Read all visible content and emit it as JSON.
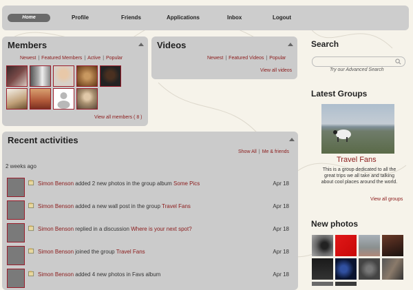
{
  "nav": {
    "home": "Home",
    "items": [
      "Profile",
      "Friends",
      "Applications",
      "Inbox",
      "Logout"
    ]
  },
  "members": {
    "title": "Members",
    "tabs": [
      "Newest",
      "Featured Members",
      "Active",
      "Popular"
    ],
    "view_all": "View all members ( 8 )"
  },
  "videos": {
    "title": "Videos",
    "tabs": [
      "Newest",
      "Featured Videos",
      "Popular"
    ],
    "view_all": "View all videos"
  },
  "activities": {
    "title": "Recent activities",
    "filters": [
      "Show All",
      "Me & friends"
    ],
    "group_label": "2 weeks ago",
    "items": [
      {
        "user": "Simon Benson",
        "text": " added 2 new photos in the group album ",
        "target": "Some Pics",
        "date": "Apr 18"
      },
      {
        "user": "Simon Benson",
        "text": " added a new wall post in the group ",
        "target": "Travel Fans",
        "date": "Apr 18"
      },
      {
        "user": "Simon Benson",
        "text": " replied in a discussion ",
        "target": "Where is your next spot?",
        "date": "Apr 18"
      },
      {
        "user": "Simon Benson",
        "text": " joined the group ",
        "target": "Travel Fans",
        "date": "Apr 18"
      },
      {
        "user": "Simon Benson",
        "text": " added 4 new photos in Favs album",
        "target": "",
        "date": "Apr 18"
      }
    ]
  },
  "search": {
    "title": "Search",
    "advanced": "Try our Advanced Search"
  },
  "latest_groups": {
    "title": "Latest Groups",
    "group_name": "Travel Fans",
    "description_lines": [
      "This is a group dedicated to all the",
      "great trips we all take and talking",
      "about cool places around the world."
    ],
    "view_all": "View all groups"
  },
  "new_photos": {
    "title": "New photos"
  },
  "colors": {
    "panel": "#cbcbcb",
    "link": "#8b1a1a",
    "background": "#f6f3ea",
    "thumb_border": "#9a1c2a"
  }
}
